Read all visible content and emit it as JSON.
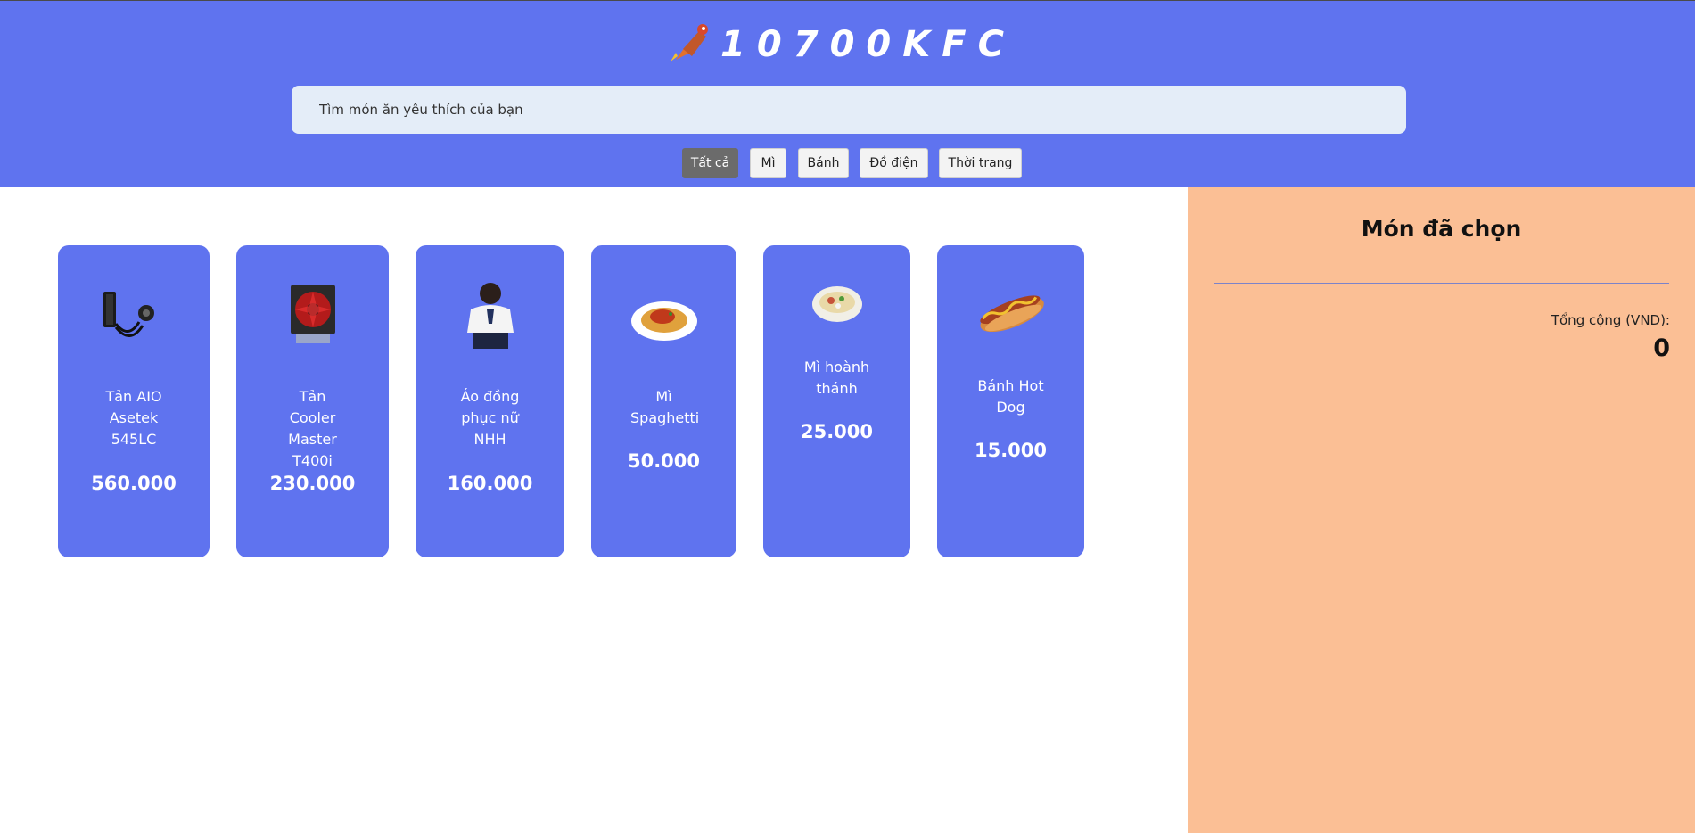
{
  "header": {
    "logo_text": "10700KFC",
    "search_placeholder": "Tìm món ăn yêu thích của bạn"
  },
  "filters": [
    {
      "label": "Tất cả",
      "active": true
    },
    {
      "label": "Mì",
      "active": false
    },
    {
      "label": "Bánh",
      "active": false
    },
    {
      "label": "Đồ điện",
      "active": false
    },
    {
      "label": "Thời trang",
      "active": false
    }
  ],
  "products": [
    {
      "name": "Tản AIO Asetek 545LC",
      "price": "560.000",
      "icon": "aio-cooler-icon"
    },
    {
      "name": "Tản Cooler Master T400i",
      "price": "230.000",
      "icon": "cpu-fan-icon"
    },
    {
      "name": "Áo đồng phục nữ NHH",
      "price": "160.000",
      "icon": "uniform-icon"
    },
    {
      "name": "Mì Spaghetti",
      "price": "50.000",
      "icon": "spaghetti-icon"
    },
    {
      "name": "Mì hoành thánh",
      "price": "25.000",
      "icon": "wonton-noodle-icon"
    },
    {
      "name": "Bánh Hot Dog",
      "price": "15.000",
      "icon": "hotdog-icon"
    }
  ],
  "cart": {
    "title": "Món đã chọn",
    "total_label": "Tổng cộng (VND):",
    "total_value": "0"
  },
  "colors": {
    "brand": "#5f73ef",
    "search_bg": "#e4edf8",
    "sidebar_bg": "#fbbf95",
    "active_filter": "#6b6b6b"
  }
}
